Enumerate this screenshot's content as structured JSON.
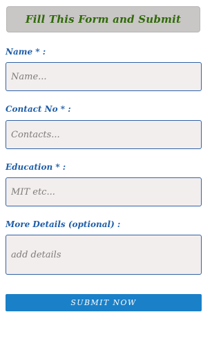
{
  "header": {
    "title": "Fill This Form and Submit"
  },
  "form": {
    "fields": [
      {
        "label": "Name * :",
        "placeholder": "Name...",
        "value": ""
      },
      {
        "label": "Contact No * :",
        "placeholder": "Contacts...",
        "value": ""
      },
      {
        "label": "Education * :",
        "placeholder": "MIT etc...",
        "value": ""
      },
      {
        "label": "More Details (optional) :",
        "placeholder": "add details",
        "value": ""
      }
    ],
    "submit_label": "SUBMIT NOW"
  },
  "colors": {
    "header_background": "#c9c6c6",
    "header_text": "#2f6b06",
    "label_text": "#1f5ea8",
    "input_background": "#f3eeee",
    "input_border": "#2f62a6",
    "button_background": "#1a80c8",
    "button_text": "#ffffff"
  }
}
